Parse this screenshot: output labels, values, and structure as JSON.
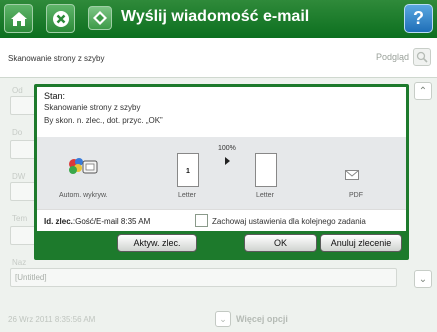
{
  "header": {
    "title": "Wyślij wiadomość e-mail",
    "help_glyph": "?"
  },
  "subheader": {
    "status": "Skanowanie strony z szyby",
    "preview_label": "Podgląd"
  },
  "background_form": {
    "labels": [
      "Od",
      "Do",
      "DW",
      "Tem",
      "Naz"
    ],
    "filename_value": "[Untitled]"
  },
  "dialog": {
    "stan_label": "Stan:",
    "line1": "Skanowanie strony z szyby",
    "line2": "By skon. n. zlec., dot. przyc. „OK”",
    "progress_percent": "100%",
    "source_label": "Autom. wykryw.",
    "page1_number": "1",
    "page1_label": "Letter",
    "page2_label": "Letter",
    "format_label": "PDF",
    "job_label": "Id. zlec.",
    "job_value": ":Gość/E-mail 8:35 AM",
    "save_settings_label": "Zachowaj ustawienia dla kolejnego zadania",
    "save_settings_checked": false,
    "buttons": {
      "active_jobs": "Aktyw. zlec.",
      "ok": "OK",
      "cancel": "Anuluj zlecenie"
    }
  },
  "status_bar": {
    "datetime": "26 Wrz 2011 8:35:56 AM",
    "more_options": "Więcej opcji"
  },
  "colors": {
    "header_green": "#0c6f1f",
    "dialog_border": "#1d7a2c",
    "help_blue": "#1f6fb8"
  }
}
